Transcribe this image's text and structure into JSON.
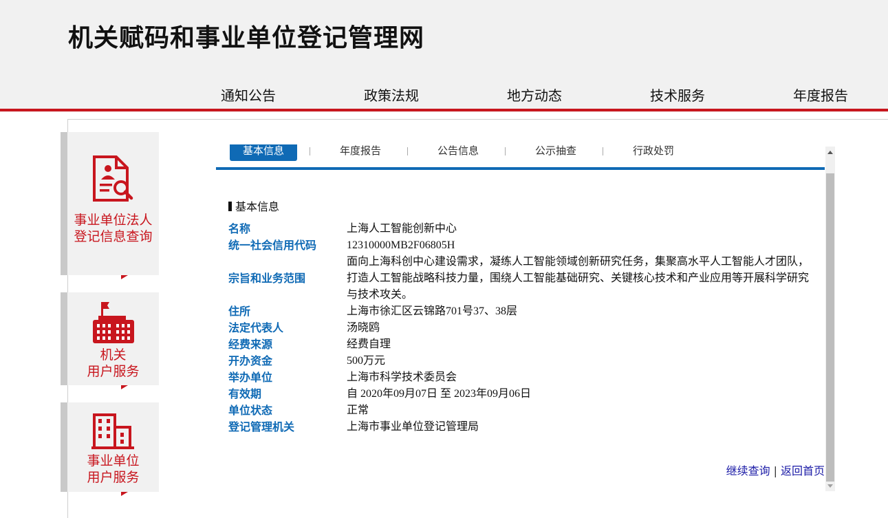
{
  "header": {
    "site_title": "机关赋码和事业单位登记管理网",
    "nav": [
      "通知公告",
      "政策法规",
      "地方动态",
      "技术服务",
      "年度报告"
    ]
  },
  "sidebar": {
    "cards": [
      {
        "line1": "事业单位法人",
        "line2": "登记信息查询",
        "icon": "person-search-icon"
      },
      {
        "line1": "机关",
        "line2": "用户服务",
        "icon": "government-building-icon"
      },
      {
        "line1": "事业单位",
        "line2": "用户服务",
        "icon": "office-building-icon"
      }
    ]
  },
  "tabs": [
    "基本信息",
    "年度报告",
    "公告信息",
    "公示抽查",
    "行政处罚"
  ],
  "info": {
    "section_title": "基本信息",
    "rows": [
      {
        "label": "名称",
        "value": "上海人工智能创新中心"
      },
      {
        "label": "统一社会信用代码",
        "value": "12310000MB2F06805H"
      },
      {
        "label": "宗旨和业务范围",
        "value": "面向上海科创中心建设需求，凝练人工智能领域创新研究任务，集聚高水平人工智能人才团队，打造人工智能战略科技力量，围绕人工智能基础研究、关键核心技术和产业应用等开展科学研究与技术攻关。"
      },
      {
        "label": "住所",
        "value": "上海市徐汇区云锦路701号37、38层"
      },
      {
        "label": "法定代表人",
        "value": "汤晓鸥"
      },
      {
        "label": "经费来源",
        "value": "经费自理"
      },
      {
        "label": "开办资金",
        "value": "500万元"
      },
      {
        "label": "举办单位",
        "value": "上海市科学技术委员会"
      },
      {
        "label": "有效期",
        "value": "自 2020年09月07日 至 2023年09月06日"
      },
      {
        "label": "单位状态",
        "value": "正常"
      },
      {
        "label": "登记管理机关",
        "value": "上海市事业单位登记管理局"
      }
    ]
  },
  "links": {
    "continue": "继续查询",
    "separator": "|",
    "home": "返回首页"
  },
  "colors": {
    "brand_red": "#c8161e",
    "accent_blue": "#0f6ab5",
    "link_blue": "#1a1aa6"
  }
}
